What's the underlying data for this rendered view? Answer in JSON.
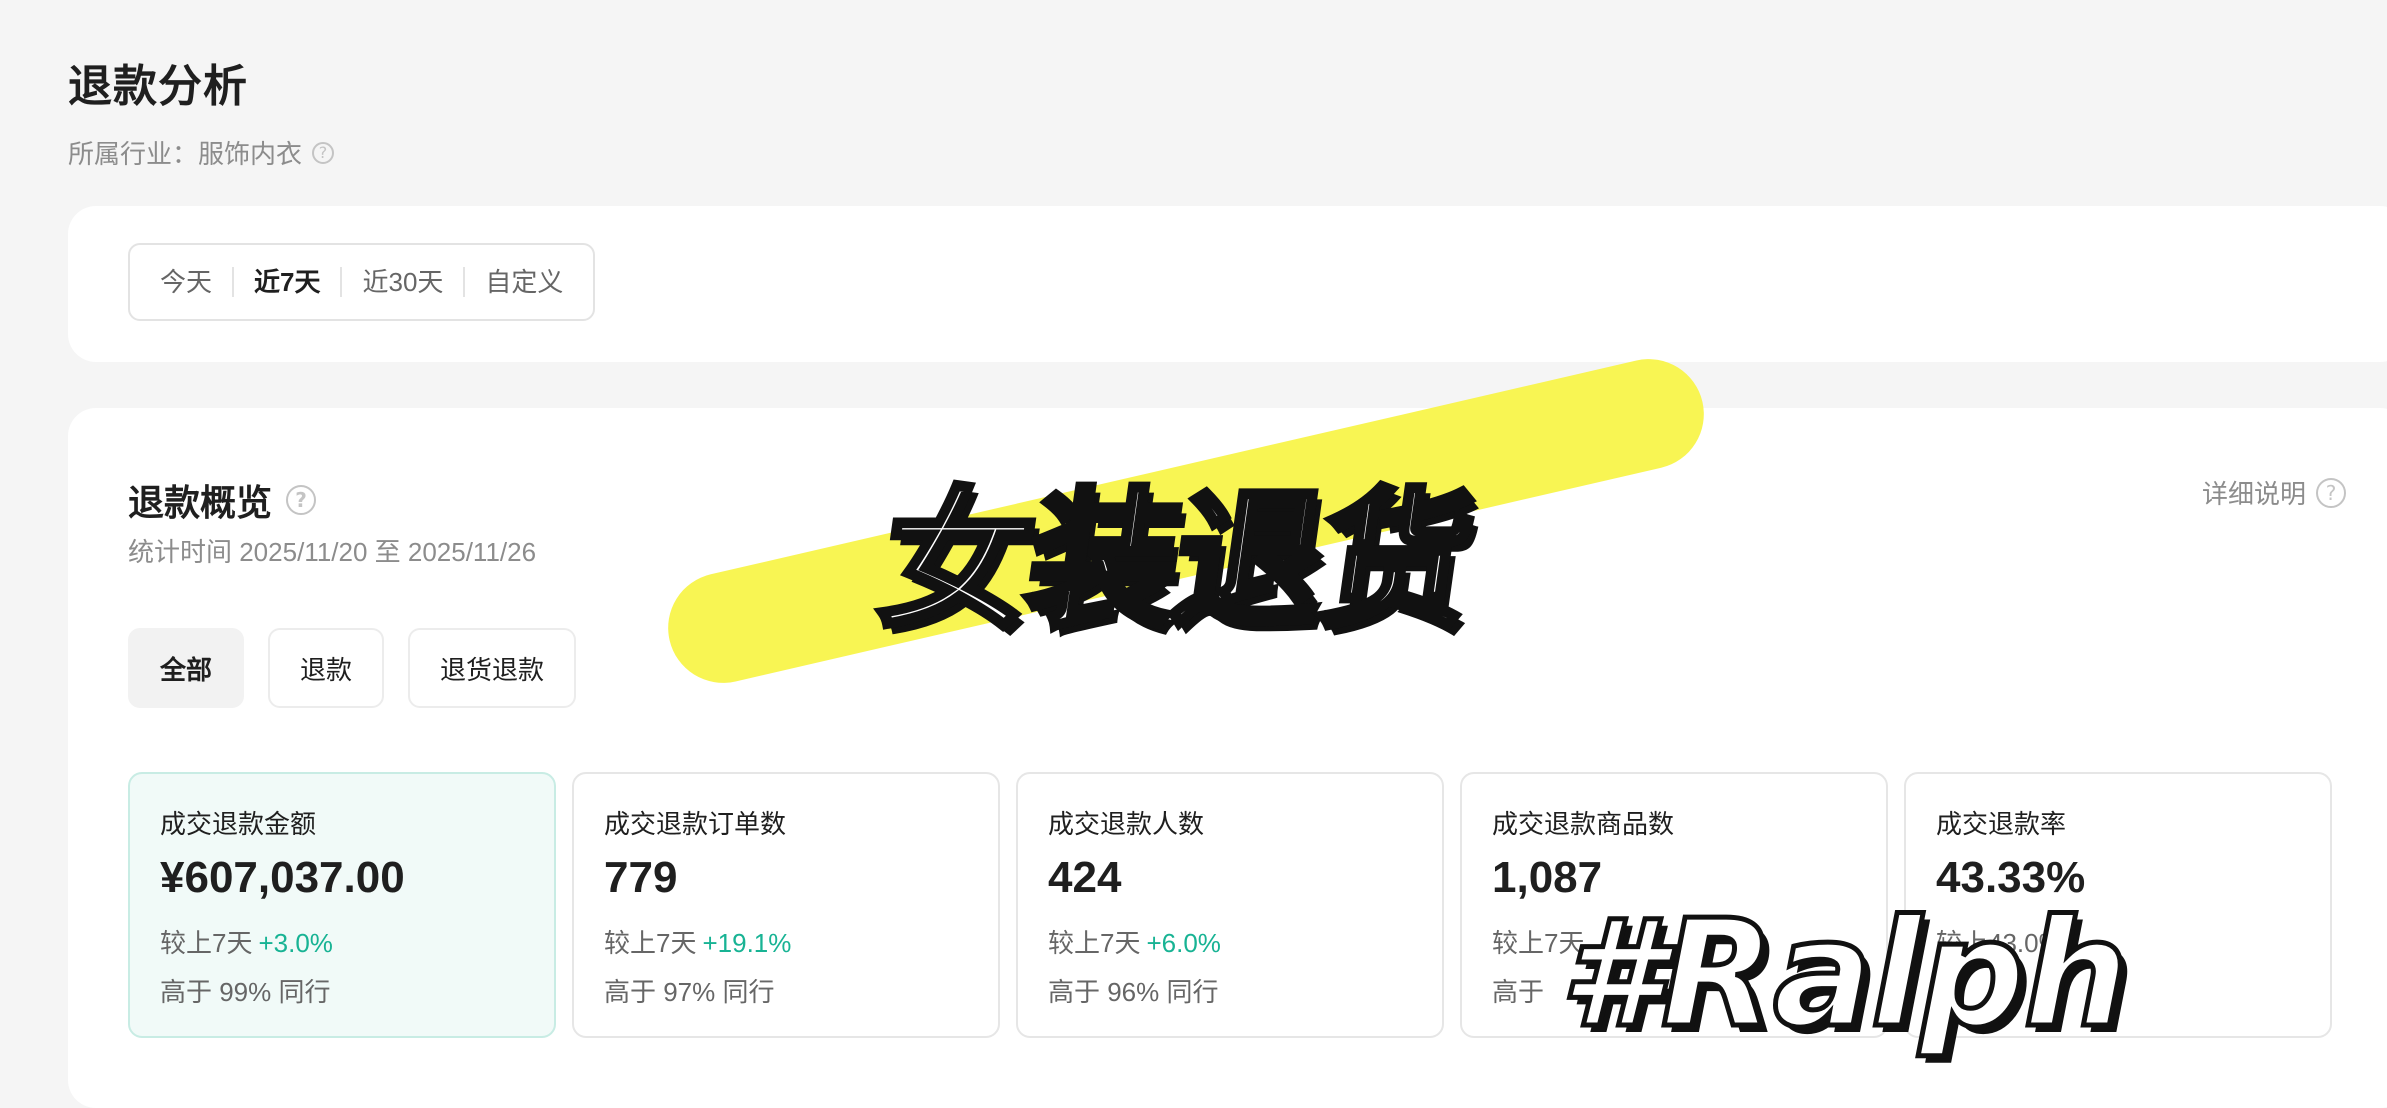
{
  "header": {
    "title": "退款分析",
    "industry": "所属行业：服饰内衣",
    "help_icon": "question-circle-icon"
  },
  "range_tabs": [
    {
      "label": "今天",
      "active": false
    },
    {
      "label": "近7天",
      "active": true
    },
    {
      "label": "近30天",
      "active": false
    },
    {
      "label": "自定义",
      "active": false
    }
  ],
  "overview": {
    "title": "退款概览",
    "time_label": "统计时间 2025/11/20 至 2025/11/26",
    "detail_link": "详细说明",
    "filters": [
      {
        "label": "全部",
        "active": true
      },
      {
        "label": "退款",
        "active": false
      },
      {
        "label": "退货退款",
        "active": false
      }
    ],
    "metrics": [
      {
        "label": "成交退款金额",
        "value": "¥607,037.00",
        "compare": "较上7天",
        "change": "+3.0%",
        "rank": "高于 99% 同行",
        "active": true
      },
      {
        "label": "成交退款订单数",
        "value": "779",
        "compare": "较上7天",
        "change": "+19.1%",
        "rank": "高于 97% 同行",
        "active": false
      },
      {
        "label": "成交退款人数",
        "value": "424",
        "compare": "较上7天",
        "change": "+6.0%",
        "rank": "高于 96% 同行",
        "active": false
      },
      {
        "label": "成交退款商品数",
        "value": "1,087",
        "compare": "较上7天",
        "change": "",
        "rank": "高于",
        "active": false
      },
      {
        "label": "成交退款率",
        "value": "43.33%",
        "compare": "较上",
        "change": "43.0%",
        "rank": "",
        "active": false
      }
    ]
  },
  "overlays": {
    "title": "女装退货",
    "tag": "#Ralph",
    "highlight_color": "#f7f444"
  },
  "colors": {
    "accent_green": "#18b394",
    "active_card_bg": "#f1faf8"
  }
}
